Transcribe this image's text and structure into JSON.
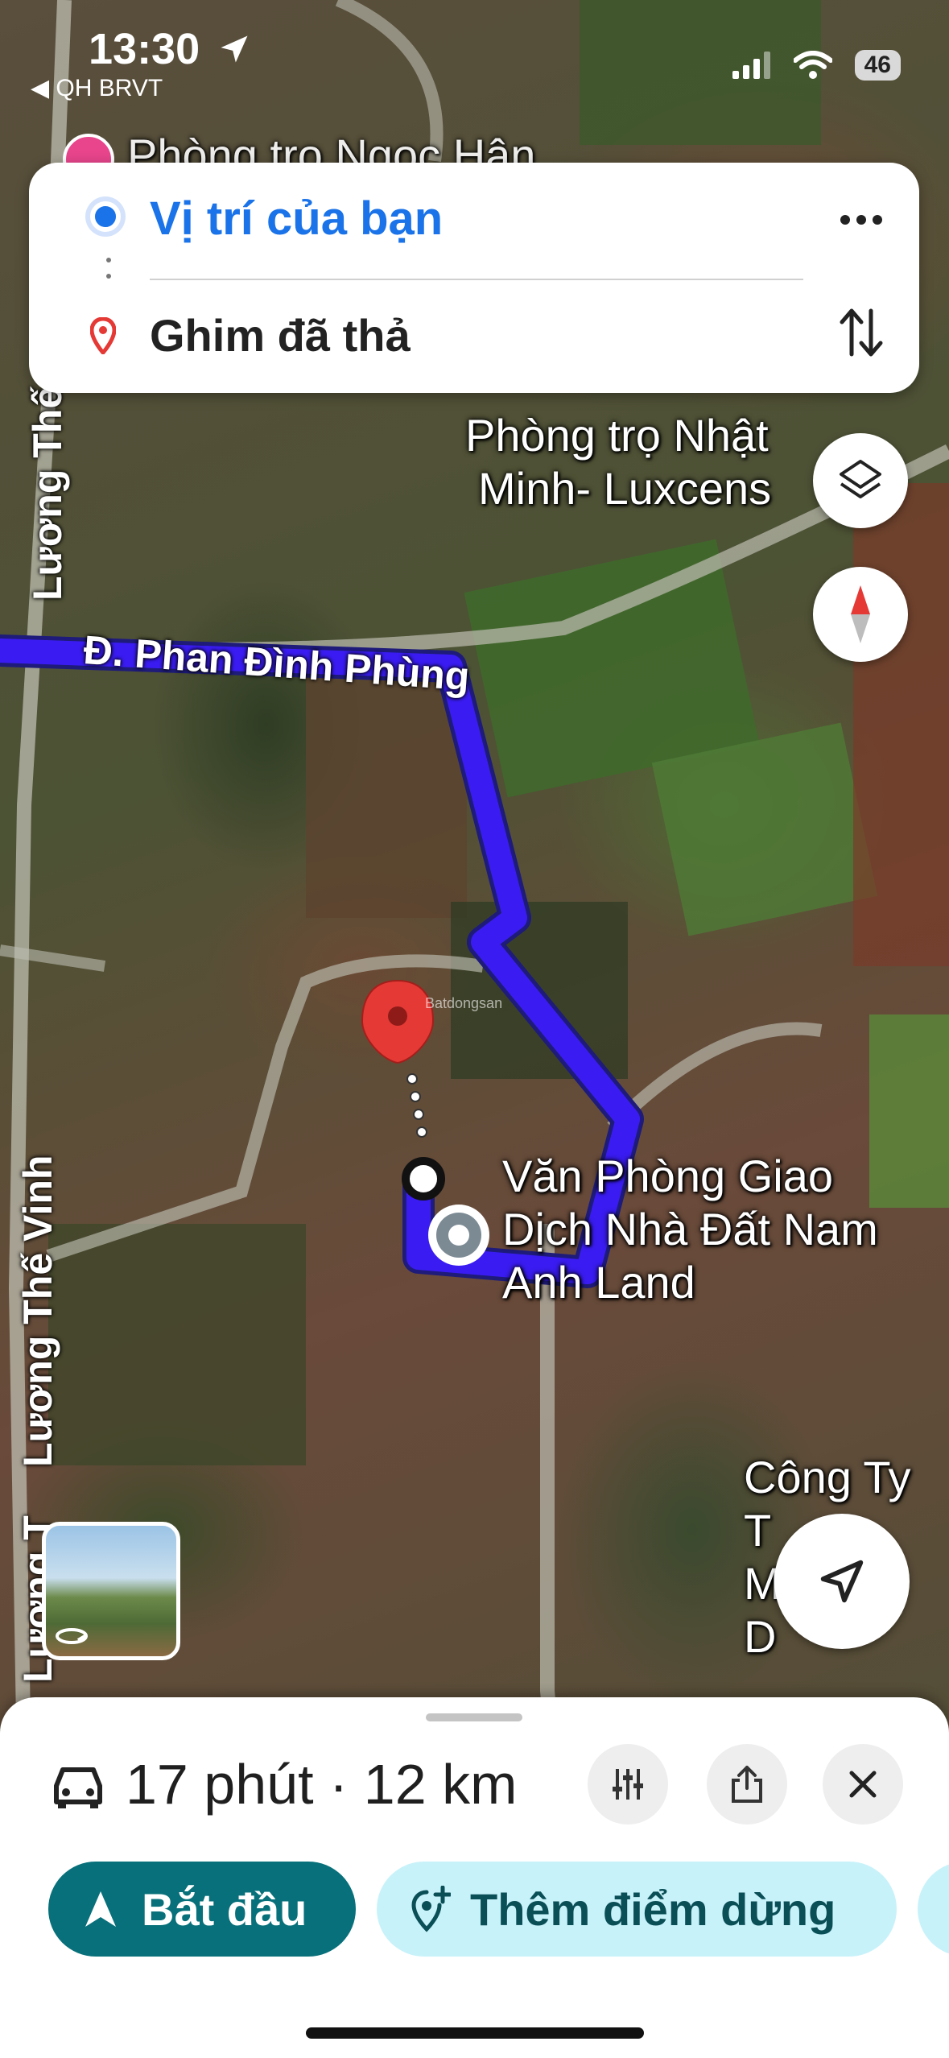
{
  "status_bar": {
    "time": "13:30",
    "carrier": "◀ QH BRVT",
    "battery": "46"
  },
  "directions_card": {
    "origin": "Vị trí của bạn",
    "destination": "Ghim đã thả",
    "more_icon": "more-horizontal-icon",
    "swap_icon": "swap-vertical-icon"
  },
  "map": {
    "partial_place_top": "Phòng trọ Ngọc Hân",
    "place_1": [
      "Phòng trọ Nhật",
      "Minh- Luxcens"
    ],
    "place_2": [
      "Văn Phòng Giao",
      "Dịch Nhà Đất Nam",
      "Anh Land"
    ],
    "place_3": [
      "Công Ty T",
      "Mai Xây D"
    ],
    "road_main": "Đ. Phan Đình Phùng",
    "road_left_top": "Lương Thế",
    "road_left_mid": "Lương Thế Vinh",
    "road_left_bottom": "Lương T",
    "watermark": "Batdongsan",
    "route_color": "#3a1cf2"
  },
  "bottom_sheet": {
    "summary": "17 phút · 12 km",
    "start_label": "Bắt đầu",
    "add_stop_label": "Thêm điểm dừng",
    "accent": "#08707a",
    "accent_light": "#c8f2fa"
  }
}
